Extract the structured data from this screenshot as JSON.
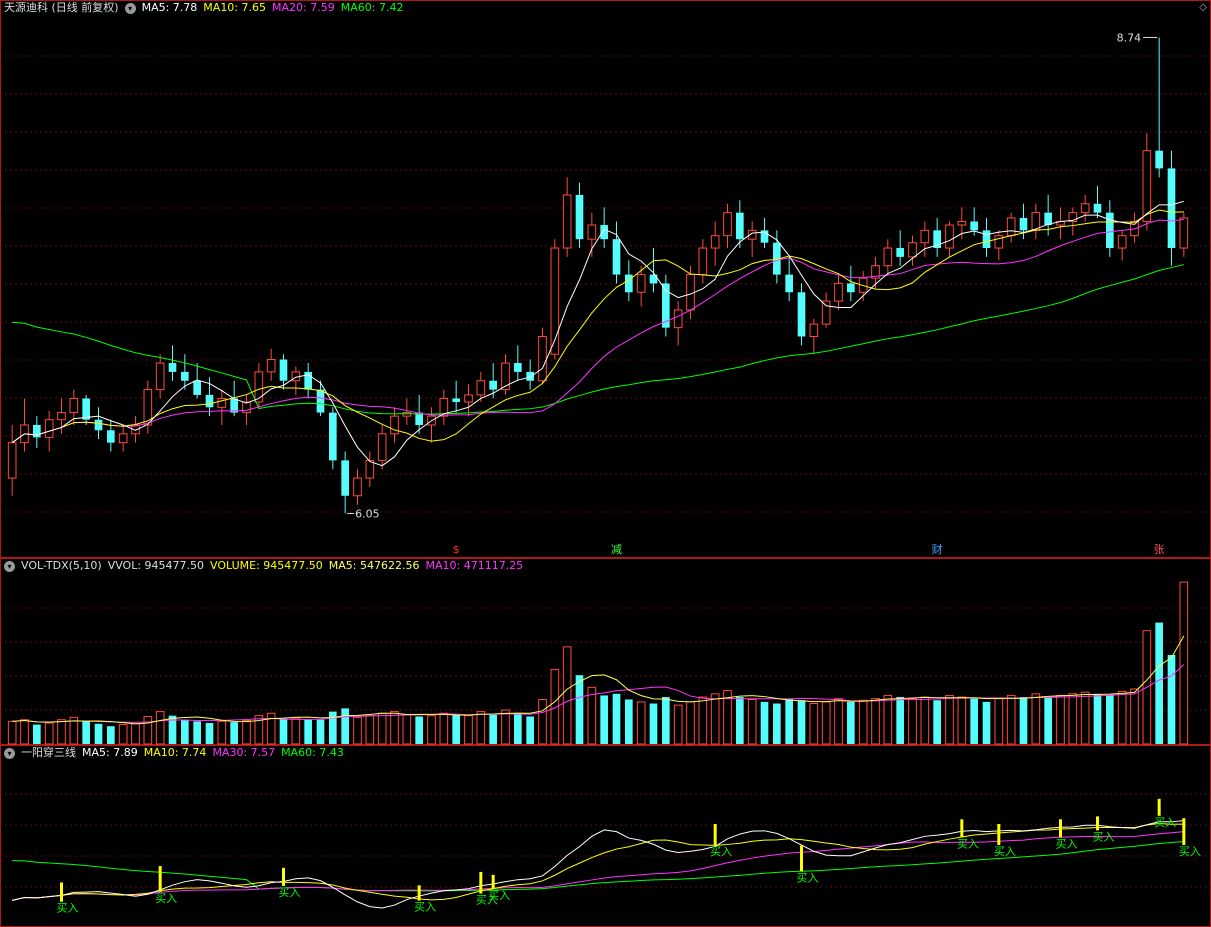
{
  "colors": {
    "up": "#ff4b3b",
    "down": "#54fcfc",
    "ma5": "#ffffff",
    "ma10": "#ffff00",
    "ma20": "#ff33ff",
    "ma60": "#00ff00",
    "volma5": "#ffff55",
    "volma10": "#ff33ff",
    "buy": "#ffff00",
    "buytext": "#00ff00",
    "grid": "#7a1010"
  },
  "price_panel": {
    "title": "天源迪科 (日线 前复权)",
    "ma5": "MA5: 7.78",
    "ma10": "MA10: 7.65",
    "ma20": "MA20: 7.59",
    "ma60": "MA60: 7.42",
    "high_label": "8.74",
    "low_label": "6.05",
    "markers": [
      {
        "text": "$",
        "color": "#ff3030"
      },
      {
        "text": "减",
        "color": "#40ff40"
      },
      {
        "text": "财",
        "color": "#40a0ff"
      },
      {
        "text": "张",
        "color": "#ff5050"
      }
    ]
  },
  "volume_panel": {
    "title": "VOL-TDX(5,10)",
    "vvol": "VVOL: 945477.50",
    "volume": "VOLUME: 945477.50",
    "ma5": "MA5: 547622.56",
    "ma10": "MA10: 471117.25"
  },
  "indicator_panel": {
    "title": "一阳穿三线",
    "ma5": "MA5: 7.89",
    "ma10": "MA10: 7.74",
    "ma30": "MA30: 7.57",
    "ma60": "MA60: 7.43",
    "buy_label": "买入"
  },
  "chart_data": {
    "type": "candlestick",
    "ylim": [
      5.9,
      8.85
    ],
    "ohlc": [
      [
        6.25,
        6.55,
        6.15,
        6.45
      ],
      [
        6.45,
        6.7,
        6.4,
        6.55
      ],
      [
        6.55,
        6.6,
        6.42,
        6.48
      ],
      [
        6.48,
        6.63,
        6.4,
        6.58
      ],
      [
        6.58,
        6.7,
        6.5,
        6.62
      ],
      [
        6.62,
        6.75,
        6.55,
        6.7
      ],
      [
        6.7,
        6.72,
        6.55,
        6.58
      ],
      [
        6.58,
        6.65,
        6.47,
        6.52
      ],
      [
        6.52,
        6.58,
        6.4,
        6.45
      ],
      [
        6.45,
        6.55,
        6.4,
        6.5
      ],
      [
        6.5,
        6.6,
        6.45,
        6.55
      ],
      [
        6.55,
        6.8,
        6.5,
        6.75
      ],
      [
        6.75,
        6.95,
        6.7,
        6.9
      ],
      [
        6.9,
        7.0,
        6.8,
        6.85
      ],
      [
        6.85,
        6.95,
        6.75,
        6.8
      ],
      [
        6.8,
        6.9,
        6.7,
        6.72
      ],
      [
        6.72,
        6.82,
        6.6,
        6.65
      ],
      [
        6.65,
        6.75,
        6.55,
        6.7
      ],
      [
        6.7,
        6.8,
        6.6,
        6.62
      ],
      [
        6.62,
        6.72,
        6.55,
        6.68
      ],
      [
        6.68,
        6.9,
        6.65,
        6.85
      ],
      [
        6.85,
        6.98,
        6.8,
        6.92
      ],
      [
        6.92,
        6.95,
        6.75,
        6.8
      ],
      [
        6.8,
        6.88,
        6.72,
        6.85
      ],
      [
        6.85,
        6.9,
        6.7,
        6.75
      ],
      [
        6.75,
        6.8,
        6.6,
        6.62
      ],
      [
        6.62,
        6.65,
        6.3,
        6.35
      ],
      [
        6.35,
        6.4,
        6.05,
        6.15
      ],
      [
        6.15,
        6.3,
        6.1,
        6.25
      ],
      [
        6.25,
        6.4,
        6.2,
        6.35
      ],
      [
        6.35,
        6.55,
        6.3,
        6.5
      ],
      [
        6.5,
        6.65,
        6.45,
        6.6
      ],
      [
        6.6,
        6.7,
        6.55,
        6.62
      ],
      [
        6.62,
        6.72,
        6.5,
        6.55
      ],
      [
        6.55,
        6.65,
        6.45,
        6.6
      ],
      [
        6.6,
        6.75,
        6.55,
        6.7
      ],
      [
        6.7,
        6.8,
        6.62,
        6.68
      ],
      [
        6.68,
        6.78,
        6.6,
        6.72
      ],
      [
        6.72,
        6.85,
        6.68,
        6.8
      ],
      [
        6.8,
        6.9,
        6.7,
        6.75
      ],
      [
        6.75,
        6.95,
        6.72,
        6.9
      ],
      [
        6.9,
        7.0,
        6.8,
        6.85
      ],
      [
        6.85,
        6.92,
        6.75,
        6.8
      ],
      [
        6.8,
        7.1,
        6.78,
        7.05
      ],
      [
        6.95,
        7.6,
        6.92,
        7.55
      ],
      [
        7.55,
        7.95,
        7.5,
        7.85
      ],
      [
        7.85,
        7.92,
        7.55,
        7.6
      ],
      [
        7.6,
        7.75,
        7.5,
        7.68
      ],
      [
        7.68,
        7.78,
        7.55,
        7.6
      ],
      [
        7.6,
        7.7,
        7.35,
        7.4
      ],
      [
        7.4,
        7.48,
        7.25,
        7.3
      ],
      [
        7.3,
        7.45,
        7.22,
        7.4
      ],
      [
        7.4,
        7.55,
        7.3,
        7.35
      ],
      [
        7.35,
        7.4,
        7.05,
        7.1
      ],
      [
        7.1,
        7.25,
        7.0,
        7.2
      ],
      [
        7.2,
        7.45,
        7.15,
        7.4
      ],
      [
        7.4,
        7.6,
        7.35,
        7.55
      ],
      [
        7.55,
        7.7,
        7.45,
        7.62
      ],
      [
        7.62,
        7.8,
        7.55,
        7.75
      ],
      [
        7.75,
        7.82,
        7.55,
        7.6
      ],
      [
        7.6,
        7.7,
        7.5,
        7.65
      ],
      [
        7.65,
        7.72,
        7.55,
        7.58
      ],
      [
        7.58,
        7.65,
        7.35,
        7.4
      ],
      [
        7.4,
        7.5,
        7.25,
        7.3
      ],
      [
        7.3,
        7.35,
        7.0,
        7.05
      ],
      [
        7.05,
        7.15,
        6.95,
        7.12
      ],
      [
        7.12,
        7.3,
        7.1,
        7.25
      ],
      [
        7.25,
        7.4,
        7.2,
        7.35
      ],
      [
        7.35,
        7.45,
        7.25,
        7.3
      ],
      [
        7.3,
        7.42,
        7.25,
        7.38
      ],
      [
        7.38,
        7.5,
        7.32,
        7.45
      ],
      [
        7.45,
        7.6,
        7.4,
        7.55
      ],
      [
        7.55,
        7.65,
        7.45,
        7.5
      ],
      [
        7.5,
        7.62,
        7.45,
        7.58
      ],
      [
        7.58,
        7.7,
        7.5,
        7.65
      ],
      [
        7.65,
        7.72,
        7.5,
        7.55
      ],
      [
        7.55,
        7.7,
        7.5,
        7.68
      ],
      [
        7.68,
        7.78,
        7.6,
        7.7
      ],
      [
        7.7,
        7.78,
        7.62,
        7.65
      ],
      [
        7.65,
        7.72,
        7.5,
        7.55
      ],
      [
        7.55,
        7.65,
        7.48,
        7.62
      ],
      [
        7.62,
        7.75,
        7.58,
        7.72
      ],
      [
        7.72,
        7.8,
        7.6,
        7.65
      ],
      [
        7.65,
        7.8,
        7.6,
        7.75
      ],
      [
        7.75,
        7.85,
        7.62,
        7.68
      ],
      [
        7.68,
        7.78,
        7.6,
        7.7
      ],
      [
        7.7,
        7.78,
        7.62,
        7.75
      ],
      [
        7.75,
        7.85,
        7.7,
        7.8
      ],
      [
        7.8,
        7.9,
        7.72,
        7.75
      ],
      [
        7.75,
        7.82,
        7.5,
        7.55
      ],
      [
        7.55,
        7.65,
        7.48,
        7.62
      ],
      [
        7.62,
        7.75,
        7.58,
        7.7
      ],
      [
        7.7,
        8.2,
        7.65,
        8.1
      ],
      [
        8.1,
        8.74,
        7.95,
        8.0
      ],
      [
        8.0,
        8.1,
        7.45,
        7.55
      ],
      [
        7.55,
        7.75,
        7.5,
        7.72
      ]
    ],
    "volume": [
      28,
      30,
      24,
      26,
      30,
      33,
      28,
      25,
      22,
      24,
      25,
      34,
      40,
      35,
      30,
      28,
      26,
      28,
      27,
      29,
      35,
      38,
      31,
      32,
      30,
      30,
      40,
      44,
      33,
      35,
      38,
      40,
      36,
      34,
      35,
      38,
      36,
      35,
      40,
      36,
      42,
      38,
      34,
      55,
      92,
      120,
      85,
      70,
      60,
      62,
      55,
      52,
      50,
      58,
      48,
      52,
      58,
      62,
      66,
      58,
      55,
      52,
      50,
      56,
      54,
      50,
      52,
      56,
      52,
      54,
      56,
      60,
      58,
      56,
      58,
      54,
      60,
      58,
      56,
      52,
      56,
      60,
      58,
      62,
      58,
      60,
      62,
      64,
      62,
      60,
      65,
      68,
      140,
      150,
      110,
      200
    ],
    "buy_signals": [
      4,
      12,
      22,
      33,
      38,
      39,
      57,
      64,
      77,
      80,
      85,
      88,
      93,
      95
    ]
  }
}
